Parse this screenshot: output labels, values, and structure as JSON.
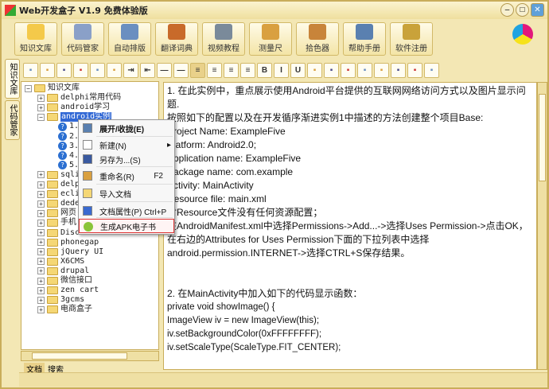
{
  "window": {
    "title": "Web开发盒子 V1.9 免费体验版"
  },
  "toolbar": [
    "知识文库",
    "代码管家",
    "自动排版",
    "翻译词典",
    "视频教程",
    "测量尺",
    "拾色器",
    "帮助手册",
    "软件注册"
  ],
  "side_tabs": [
    "知识文库",
    "代码管家"
  ],
  "format_buttons": [
    "new",
    "open",
    "save",
    "export",
    "preview",
    "find-doc",
    "indent",
    "outdent",
    "hr1",
    "hr2",
    "align-left",
    "align-center",
    "align-right",
    "justify",
    "B",
    "I",
    "U",
    "insert-file",
    "find",
    "edit",
    "font",
    "image",
    "table",
    "sound",
    "clear"
  ],
  "tree": {
    "root": "知识文库",
    "children": [
      "delphi常用代码",
      "android学习",
      "android实例"
    ],
    "selected_children": [
      "1.",
      "2.",
      "3.",
      "4.",
      "5."
    ],
    "rest": [
      "sqlit",
      "delph",
      "eclip",
      "dedec",
      "网页",
      "手机",
      "Discuz!",
      "phonegap",
      "jQuery UI",
      "X6CMS",
      "drupal",
      "微信接口",
      "zen cart",
      "3gcms",
      "电商盒子"
    ]
  },
  "bottom_tabs": [
    "文档",
    "搜索"
  ],
  "context_menu": [
    {
      "label": "展开/收拢(E)",
      "shortcut": "",
      "icon": "expand-icon"
    },
    {
      "label": "新建(N)",
      "shortcut": "",
      "icon": "new-doc-icon",
      "submenu": true
    },
    {
      "label": "另存为...(S)",
      "shortcut": "",
      "icon": "save-icon"
    },
    {
      "label": "重命名(R)",
      "shortcut": "F2",
      "icon": "rename-icon"
    },
    {
      "label": "导入文档",
      "shortcut": "",
      "icon": "folder-icon"
    },
    {
      "label": "文档属性(P) Ctrl+P",
      "shortcut": "",
      "icon": "properties-icon"
    },
    {
      "label": "生成APK电子书",
      "shortcut": "",
      "icon": "android-icon"
    }
  ],
  "editor": {
    "lines": [
      "1. 在此实例中，重点展示使用Android平台提供的互联网网络访问方式以及图片显示问题.",
      "按照如下的配置以及在开发循序渐进实例1中描述的方法创建整个项目Base:",
      "Project Name: ExampleFive",
      "Platform: Android2.0;",
      "Application name: ExampleFive",
      "Package name: com.example",
      "Activity: MainActivity",
      "Resource file: main.xml",
      "对Resource文件没有任何资源配置；",
      "在AndroidManifest.xml中选择Permissions->Add...->选择Uses Permission->点击OK，在右边的Attributes for Uses Permission下面的下拉列表中选择android.permission.INTERNET->选择CTRL+S保存结果。",
      "",
      "",
      "2. 在MainActivity中加入如下的代码显示函数：",
      " private void showImage() {",
      "  ImageView iv = new ImageView(this);",
      "  iv.setBackgroundColor(0xFFFFFFFF);",
      "  iv.setScaleType(ScaleType.FIT_CENTER);"
    ]
  }
}
